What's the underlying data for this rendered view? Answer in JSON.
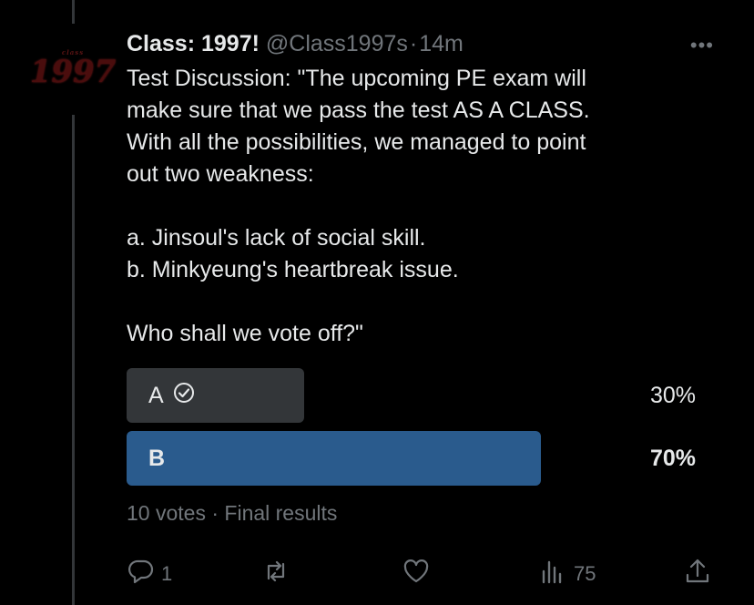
{
  "tweet": {
    "display_name": "Class: 1997!",
    "handle": "@Class1997s",
    "separator": "·",
    "time": "14m",
    "more": "•••",
    "avatar_top": "class",
    "avatar_big": "1997",
    "text": "Test Discussion: \"The upcoming PE exam will\nmake sure that we pass the test AS A CLASS.\nWith all the possibilities, we managed to point\nout two weakness:\n\na. Jinsoul's lack of social skill.\nb. Minkyeung's heartbreak issue.\n\nWho shall we vote off?\""
  },
  "poll": {
    "options": [
      {
        "label": "A",
        "percent": "30%",
        "share": 0.3,
        "voted": true
      },
      {
        "label": "B",
        "percent": "70%",
        "share": 0.7,
        "voted": false
      }
    ],
    "votes": "10 votes",
    "dot": "·",
    "status": "Final results"
  },
  "actions": {
    "reply_count": "1",
    "retweet_count": "",
    "like_count": "",
    "views_count": "75"
  },
  "colors": {
    "background": "#000000",
    "text": "#e7e9ea",
    "muted": "#71767b",
    "winning_bar": "#2a5b8d",
    "losing_bar": "#333639"
  }
}
